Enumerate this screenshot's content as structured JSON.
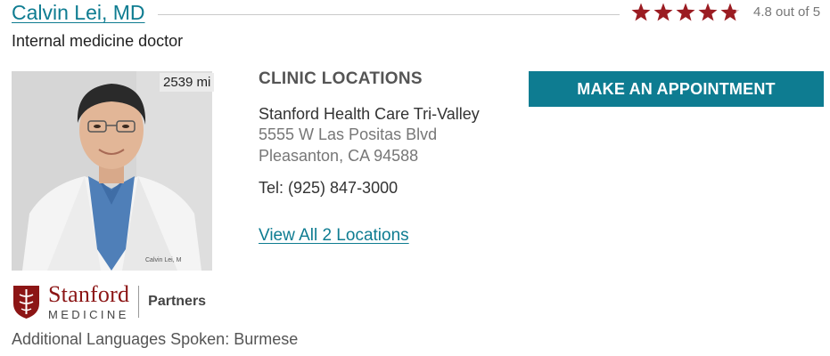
{
  "doctor": {
    "name": "Calvin Lei, MD",
    "specialty": "Internal medicine doctor",
    "rating": 4.8,
    "rating_text": "4.8 out of 5",
    "distance": "2539 mi",
    "photo_badge": "Calvin Lei, M"
  },
  "clinic": {
    "heading": "CLINIC LOCATIONS",
    "name": "Stanford Health Care Tri-Valley",
    "street": "5555 W Las Positas Blvd",
    "city": "Pleasanton, CA 94588",
    "tel": "Tel: (925) 847-3000",
    "view_all": "View All 2 Locations"
  },
  "actions": {
    "appointment": "MAKE AN APPOINTMENT"
  },
  "affiliation": {
    "stanford": "Stanford",
    "medicine": "MEDICINE",
    "partners": "Partners"
  },
  "languages": "Additional Languages Spoken: Burmese",
  "colors": {
    "accent": "#0e7c91",
    "star": "#9b1c22",
    "brand": "#8c1515"
  },
  "icons": {
    "rating": "star-icon",
    "logo": "stanford-shield-icon"
  }
}
